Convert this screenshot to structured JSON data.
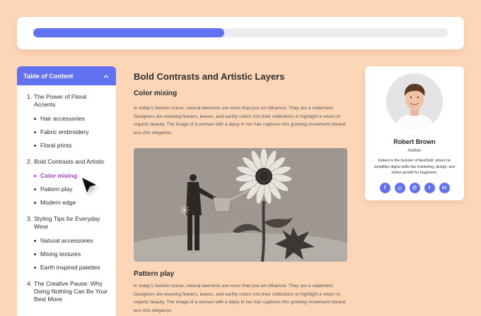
{
  "progress": {
    "value_percent": 46,
    "fill_color": "#6271f0"
  },
  "toc": {
    "title": "Table of Content",
    "sections": [
      {
        "num": "1.",
        "label": "The Power of Floral Accents",
        "items": [
          {
            "label": "Hair accessories"
          },
          {
            "label": "Fabric embroidery"
          },
          {
            "label": "Floral prints"
          }
        ]
      },
      {
        "num": "2.",
        "label": "Bold Contrasts and Artistic",
        "items": [
          {
            "label": "Color mixing",
            "active": true
          },
          {
            "label": "Pattern play"
          },
          {
            "label": "Modern edge"
          }
        ]
      },
      {
        "num": "3.",
        "label": "Styling Tips for Everyday Wear",
        "items": [
          {
            "label": "Natural accessories"
          },
          {
            "label": "Mixing textures"
          },
          {
            "label": "Earth inspired palettes"
          }
        ]
      },
      {
        "num": "4.",
        "label": "The Creative Pause: Why Doing Nothing Can Be Your Best Move",
        "items": []
      }
    ]
  },
  "article": {
    "title": "Bold Contrasts and Artistic Layers",
    "section1": {
      "heading": "Color mixing",
      "body": "In today’s fashion scene, natural elements are more than just an influence. They are a statement. Designers are weaving flowers, leaves, and earthy colors into their collections to highlight a return to organic beauty. The image of a woman with a daisy in her hair captures this growing movement toward eco chic elegance."
    },
    "section2": {
      "heading": "Pattern play",
      "body": "In today’s fashion scene, natural elements are more than just an influence. They are a statement. Designers are weaving flowers, leaves, and earthy colors into their collections to highlight a return to organic beauty. The image of a woman with a daisy in her hair captures this growing movement toward eco chic elegance."
    }
  },
  "author": {
    "name": "Robert Brown",
    "role": "Author",
    "bio": "Robert is the founder of NextSkill, where he simplifies digital skills like marketing, design, and online growth for beginners.",
    "socials": [
      {
        "icon": "facebook-icon",
        "glyph": "f"
      },
      {
        "icon": "instagram-icon",
        "glyph": "◎"
      },
      {
        "icon": "threads-icon",
        "glyph": "@"
      },
      {
        "icon": "twitter-icon",
        "glyph": "t"
      },
      {
        "icon": "linkedin-icon",
        "glyph": "in"
      }
    ]
  },
  "colors": {
    "background": "#fdd6b8",
    "accent": "#6271f0",
    "active_link": "#b335d9"
  }
}
